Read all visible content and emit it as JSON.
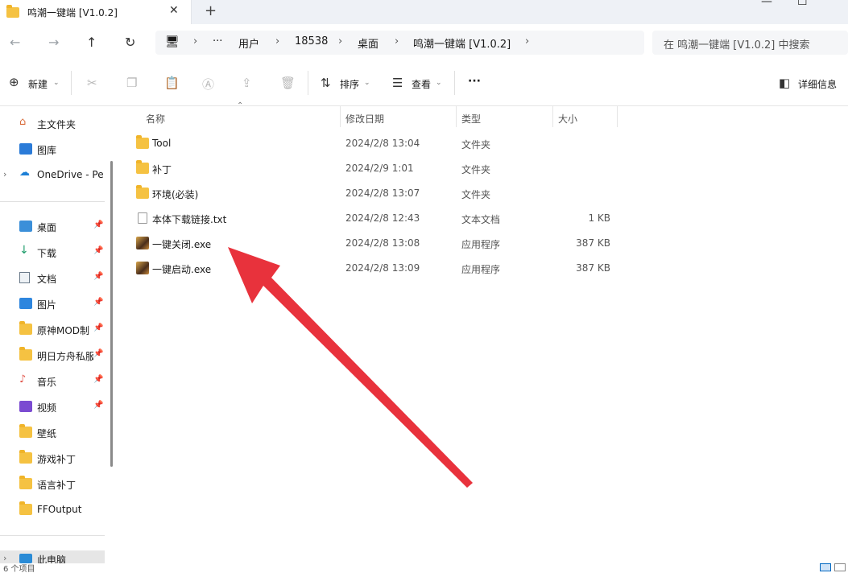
{
  "window": {
    "tab_title": "鸣潮一键端 [V1.0.2]",
    "tab_close": "✕",
    "new_tab": "+",
    "minimize": "—",
    "maximize": "☐"
  },
  "nav": {
    "back": "←",
    "forward": "→",
    "up": "↑",
    "refresh": "↻",
    "breadcrumbs": [
      "用户",
      "18538",
      "桌面",
      "鸣潮一键端 [V1.0.2]"
    ],
    "ellipsis": "···",
    "search_placeholder": "在 鸣潮一键端 [V1.0.2] 中搜索"
  },
  "toolbar": {
    "new_label": "新建",
    "sort_label": "排序",
    "view_label": "查看",
    "more_label": "···",
    "details_label": "详细信息"
  },
  "sidebar": {
    "top": [
      {
        "label": "主文件夹",
        "icon": "home-icon"
      },
      {
        "label": "图库",
        "icon": "gallery-icon"
      },
      {
        "label": "OneDrive - Per",
        "icon": "cloud-icon"
      }
    ],
    "quick": [
      {
        "label": "桌面",
        "icon": "desktop-icon",
        "pinned": true
      },
      {
        "label": "下载",
        "icon": "download-icon",
        "pinned": true
      },
      {
        "label": "文档",
        "icon": "document-icon",
        "pinned": true
      },
      {
        "label": "图片",
        "icon": "pictures-icon",
        "pinned": true
      },
      {
        "label": "原神MOD制",
        "icon": "folder-icon",
        "pinned": true
      },
      {
        "label": "明日方舟私服",
        "icon": "folder-icon",
        "pinned": true
      },
      {
        "label": "音乐",
        "icon": "music-icon",
        "pinned": true
      },
      {
        "label": "视频",
        "icon": "video-icon",
        "pinned": true
      },
      {
        "label": "壁纸",
        "icon": "folder-icon",
        "pinned": false
      },
      {
        "label": "游戏补丁",
        "icon": "folder-icon",
        "pinned": false
      },
      {
        "label": "语言补丁",
        "icon": "folder-icon",
        "pinned": false
      },
      {
        "label": "FFOutput",
        "icon": "folder-icon",
        "pinned": false
      }
    ],
    "this_pc": "此电脑"
  },
  "columns": {
    "name": "名称",
    "date": "修改日期",
    "type": "类型",
    "size": "大小"
  },
  "files": [
    {
      "name": "Tool",
      "date": "2024/2/8 13:04",
      "type": "文件夹",
      "size": "",
      "icon": "folder-icon"
    },
    {
      "name": "补丁",
      "date": "2024/2/9 1:01",
      "type": "文件夹",
      "size": "",
      "icon": "folder-icon"
    },
    {
      "name": "环境(必装)",
      "date": "2024/2/8 13:07",
      "type": "文件夹",
      "size": "",
      "icon": "folder-icon"
    },
    {
      "name": "本体下载链接.txt",
      "date": "2024/2/8 12:43",
      "type": "文本文档",
      "size": "1 KB",
      "icon": "text-file-icon"
    },
    {
      "name": "一键关闭.exe",
      "date": "2024/2/8 13:08",
      "type": "应用程序",
      "size": "387 KB",
      "icon": "exe-icon"
    },
    {
      "name": "一键启动.exe",
      "date": "2024/2/8 13:09",
      "type": "应用程序",
      "size": "387 KB",
      "icon": "exe-icon"
    }
  ],
  "status": {
    "item_count": "6 个项目"
  },
  "colors": {
    "accent": "#0067c0",
    "arrow": "#e8323c",
    "folder": "#f5c242"
  }
}
